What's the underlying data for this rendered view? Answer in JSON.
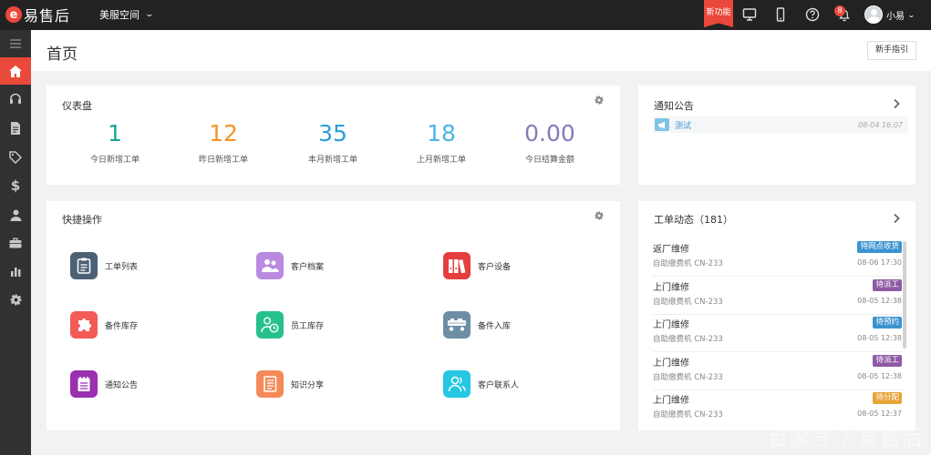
{
  "topbar": {
    "logo_text": "易售后",
    "space_label": "美服空间",
    "new_feature": "新功能",
    "notification_count": "8",
    "user_name": "小易"
  },
  "sidebar": {
    "items": [
      "menu-toggle",
      "home",
      "headset",
      "document",
      "tag",
      "dollar",
      "person",
      "briefcase",
      "bar-chart",
      "gear"
    ]
  },
  "header": {
    "title": "首页",
    "guide_button": "新手指引"
  },
  "dashboard": {
    "title": "仪表盘",
    "stats": [
      {
        "value": "1",
        "label": "今日新增工单",
        "color": "#18a58f"
      },
      {
        "value": "12",
        "label": "昨日新增工单",
        "color": "#f0942a"
      },
      {
        "value": "35",
        "label": "本月新增工单",
        "color": "#2a9fd8"
      },
      {
        "value": "18",
        "label": "上月新增工单",
        "color": "#4ab4e2"
      },
      {
        "value": "0.00",
        "label": "今日结算金额",
        "color": "#8a79b8"
      }
    ]
  },
  "quick_actions": {
    "title": "快捷操作",
    "items": [
      {
        "label": "工单列表",
        "icon": "clipboard-icon",
        "color": "#4d6175"
      },
      {
        "label": "客户档案",
        "icon": "users-icon",
        "color": "#b98ae0"
      },
      {
        "label": "客户设备",
        "icon": "binders-icon",
        "color": "#e53e3e"
      },
      {
        "label": "备件库存",
        "icon": "puzzle-icon",
        "color": "#f35b57"
      },
      {
        "label": "员工库存",
        "icon": "user-clock-icon",
        "color": "#26c08c"
      },
      {
        "label": "备件入库",
        "icon": "truck-icon",
        "color": "#6d8ea5"
      },
      {
        "label": "通知公告",
        "icon": "notepad-icon",
        "color": "#9a2fb0"
      },
      {
        "label": "知识分享",
        "icon": "book-icon",
        "color": "#f48a58"
      },
      {
        "label": "客户联系人",
        "icon": "contacts-icon",
        "color": "#25c7e3"
      }
    ]
  },
  "notices": {
    "title": "通知公告",
    "items": [
      {
        "text": "测试",
        "time": "08-04 16:07"
      }
    ]
  },
  "tickets": {
    "title": "工单动态（181）",
    "items": [
      {
        "title": "返厂维修",
        "sub": "自助缴费机   CN-233",
        "status": "待网点收货",
        "status_color": "#3b93d0",
        "time": "08-06 17:30"
      },
      {
        "title": "上门维修",
        "sub": "自助缴费机   CN-233",
        "status": "待派工",
        "status_color": "#8e5aa5",
        "time": "08-05 12:38"
      },
      {
        "title": "上门维修",
        "sub": "自助缴费机   CN-233",
        "status": "待预约",
        "status_color": "#3b93d0",
        "time": "08-05 12:38"
      },
      {
        "title": "上门维修",
        "sub": "自助缴费机   CN-233",
        "status": "待派工",
        "status_color": "#8e5aa5",
        "time": "08-05 12:38"
      },
      {
        "title": "上门维修",
        "sub": "自助缴费机   CN-233",
        "status": "待分配",
        "status_color": "#e6a336",
        "time": "08-05 12:37"
      }
    ]
  },
  "watermark": "百家号 / 易售后"
}
